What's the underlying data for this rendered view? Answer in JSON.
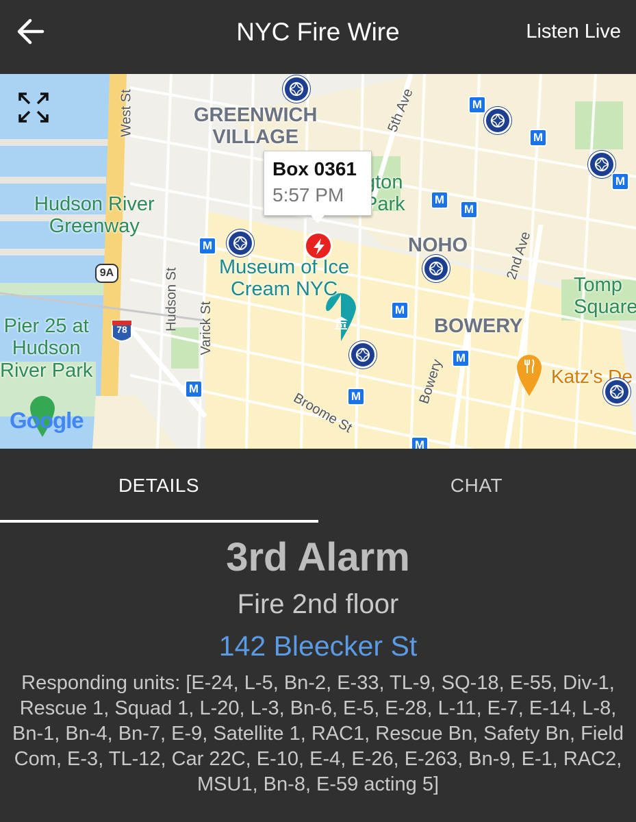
{
  "header": {
    "title": "NYC Fire Wire",
    "listen_live": "Listen Live",
    "back_icon": "arrow-left-icon"
  },
  "map": {
    "labels": {
      "greenwich_village": "GREENWICH\nVILLAGE",
      "hudson_greenway": "Hudson River\nGreenway",
      "washington_park_partial": "gton\nPark",
      "noho": "NOHO",
      "museum": "Museum of Ice\nCream NYC",
      "bowery_area": "BOWERY",
      "pier25": "Pier 25 at\nHudson\nRiver Park",
      "tompkins_partial": "Tomp\nSquare",
      "katz_partial": "Katz's De",
      "west_st": "West St",
      "fifth_ave": "5th Ave",
      "hudson_st": "Hudson St",
      "varick_st": "Varick St",
      "second_ave": "2nd Ave",
      "bowery_st": "Bowery",
      "broome_st": "Broome St",
      "route_9a": "9A",
      "route_78": "78",
      "google": "Google"
    },
    "info_window": {
      "box": "Box 0361",
      "time": "5:57 PM"
    },
    "colors": {
      "water": "#a9d3f5",
      "fd_icon": "#1d3f8f",
      "metro": "#1a73e8",
      "incident": "#e8231f"
    }
  },
  "tabs": {
    "details": "DETAILS",
    "chat": "CHAT"
  },
  "incident": {
    "alarm_level": "3rd Alarm",
    "description": "Fire 2nd floor",
    "address": "142 Bleecker St",
    "units": "Responding units: [E-24, L-5, Bn-2, E-33, TL-9, SQ-18, E-55, Div-1, Rescue 1, Squad 1, L-20, L-3, Bn-6, E-5, E-28, L-11, E-7, E-14, L-8, Bn-1, Bn-4, Bn-7, E-9, Satellite 1, RAC1, Rescue Bn, Safety Bn, Field Com, E-3, TL-12, Car 22C, E-10, E-4, E-26, E-263, Bn-9, E-1, RAC2, MSU1, Bn-8, E-59 acting 5]"
  }
}
